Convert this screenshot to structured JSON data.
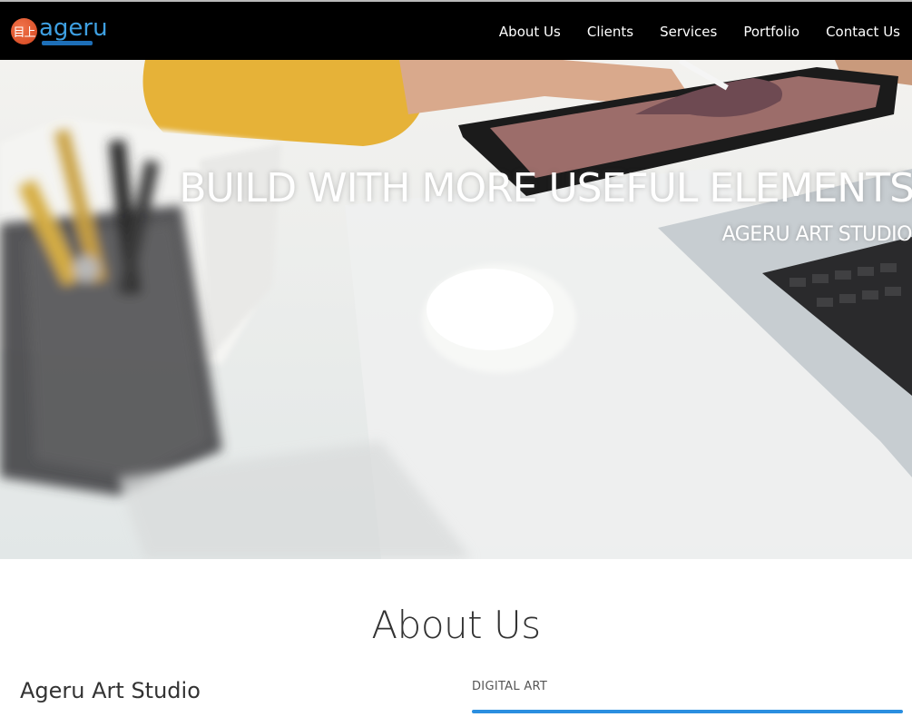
{
  "brand": {
    "logo_mark": "目上",
    "logo_word": "ageru",
    "accent": "#3ea0e2",
    "logo_red": "#d4451e"
  },
  "nav": {
    "items": [
      "About Us",
      "Clients",
      "Services",
      "Portfolio",
      "Contact Us"
    ]
  },
  "hero": {
    "title": "BUILD WITH MORE USEFUL ELEMENTS",
    "subtitle": "AGERU ART STUDIO"
  },
  "about": {
    "heading": "About Us",
    "studio_name": "Ageru Art Studio",
    "skills": [
      {
        "label": "DIGITAL ART",
        "level": 1.0,
        "color": "#2b8fe0"
      }
    ]
  }
}
